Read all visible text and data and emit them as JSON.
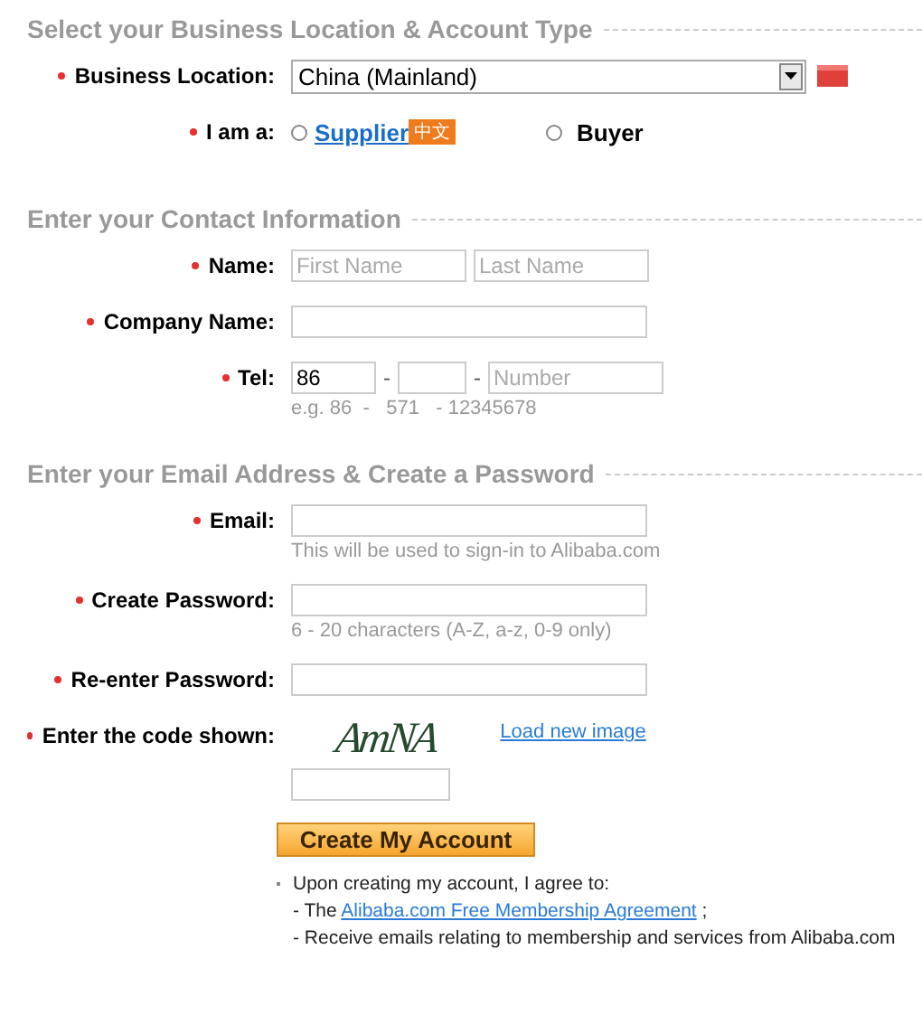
{
  "sections": [
    {
      "title": "Select your Business Location & Account Type",
      "rows": [
        {
          "kind": "select",
          "label": "Business Location:",
          "required": true,
          "value": "China (Mainland)"
        },
        {
          "kind": "radio",
          "label": "I am a:",
          "required": true,
          "options": [
            {
              "label": "Supplier",
              "badge": "中文",
              "link": true,
              "selected": false
            },
            {
              "label": "Buyer",
              "link": false,
              "selected": false
            }
          ]
        }
      ]
    },
    {
      "title": "Enter your Contact Information",
      "rows": [
        {
          "kind": "inputs",
          "label": "Name:",
          "required": true,
          "fields": [
            {
              "placeholder": "First Name"
            },
            {
              "placeholder": "Last Name"
            }
          ]
        },
        {
          "kind": "inputs",
          "label": "Company Name:",
          "required": true
        },
        {
          "kind": "inputs",
          "label": "Tel:",
          "required": true,
          "fields": [
            {
              "value": "86"
            },
            {
              "separator": "-"
            },
            {
              "separator": "-",
              "placeholder": "Number"
            }
          ],
          "hint": "e.g. 86  -   571   - 12345678"
        }
      ]
    },
    {
      "title": "Enter your Email Address & Create a Password",
      "rows": [
        {
          "kind": "inputs",
          "label": "Email:",
          "required": true,
          "hint": "This will be used to sign-in to Alibaba.com"
        },
        {
          "kind": "inputs",
          "label": "Create Password:",
          "required": true,
          "hint": "6 - 20 characters (A-Z, a-z, 0-9 only)"
        },
        {
          "kind": "inputs",
          "label": "Re-enter Password:",
          "required": true
        },
        {
          "kind": "captcha",
          "label": "Enter the code shown:",
          "required": true,
          "code": "AmNA",
          "reload": "Load new image"
        }
      ]
    }
  ],
  "submit": "Create My Account",
  "agreement": [
    {
      "kind": "text",
      "text": "Upon creating my account, I agree to:"
    },
    {
      "kind": "link",
      "prefix": "- The ",
      "link": "Alibaba.com Free Membership Agreement",
      "suffix": " ;"
    },
    {
      "kind": "text",
      "text": "- Receive emails relating to membership and services from Alibaba.com"
    }
  ]
}
